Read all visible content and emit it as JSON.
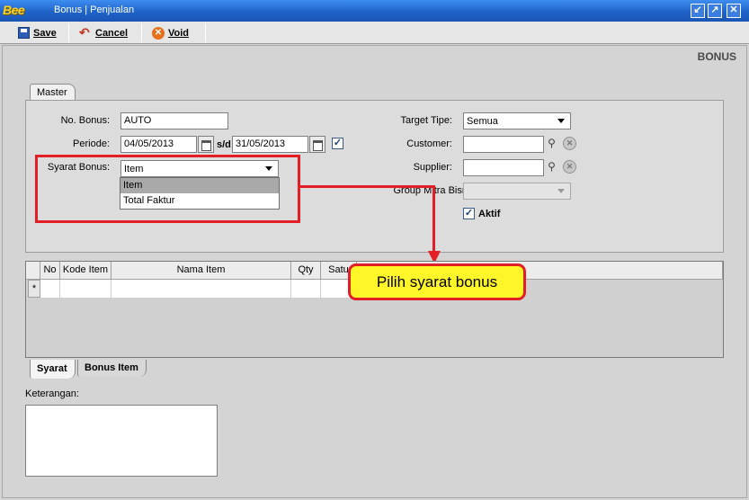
{
  "window": {
    "logo": "Bee",
    "title": "Bonus | Penjualan",
    "buttons": [
      "minimize-icon",
      "restore-icon",
      "close-icon"
    ]
  },
  "toolbar": {
    "save_label": "Save",
    "cancel_label": "Cancel",
    "void_label": "Void"
  },
  "section_title": "BONUS",
  "tabs_top": {
    "master": "Master"
  },
  "form": {
    "no_bonus_label": "No. Bonus:",
    "no_bonus_value": "AUTO",
    "periode_label": "Periode:",
    "periode_from": "04/05/2013",
    "periode_sep": "s/d",
    "periode_to": "31/05/2013",
    "periode_checked": true,
    "syarat_label": "Syarat Bonus:",
    "syarat_value": "Item",
    "syarat_options": [
      "Item",
      "Total Faktur"
    ],
    "target_tipe_label": "Target Tipe:",
    "target_tipe_value": "Semua",
    "customer_label": "Customer:",
    "customer_value": "",
    "supplier_label": "Supplier:",
    "supplier_value": "",
    "group_label": "Group Mitra Bisnis:",
    "group_value": "",
    "aktif_label": "Aktif",
    "aktif_checked": true
  },
  "grid": {
    "columns": [
      "No",
      "Kode Item",
      "Nama Item",
      "Qty",
      "Satu"
    ],
    "new_row_marker": "*"
  },
  "callout": "Pilih syarat bonus",
  "bottom_tabs": {
    "syarat": "Syarat",
    "bonus_item": "Bonus Item"
  },
  "keterangan": {
    "label": "Keterangan:",
    "value": ""
  },
  "colors": {
    "highlight": "#e31e24",
    "callout_bg": "#fff62a",
    "titlebar": "#1f63c9"
  }
}
